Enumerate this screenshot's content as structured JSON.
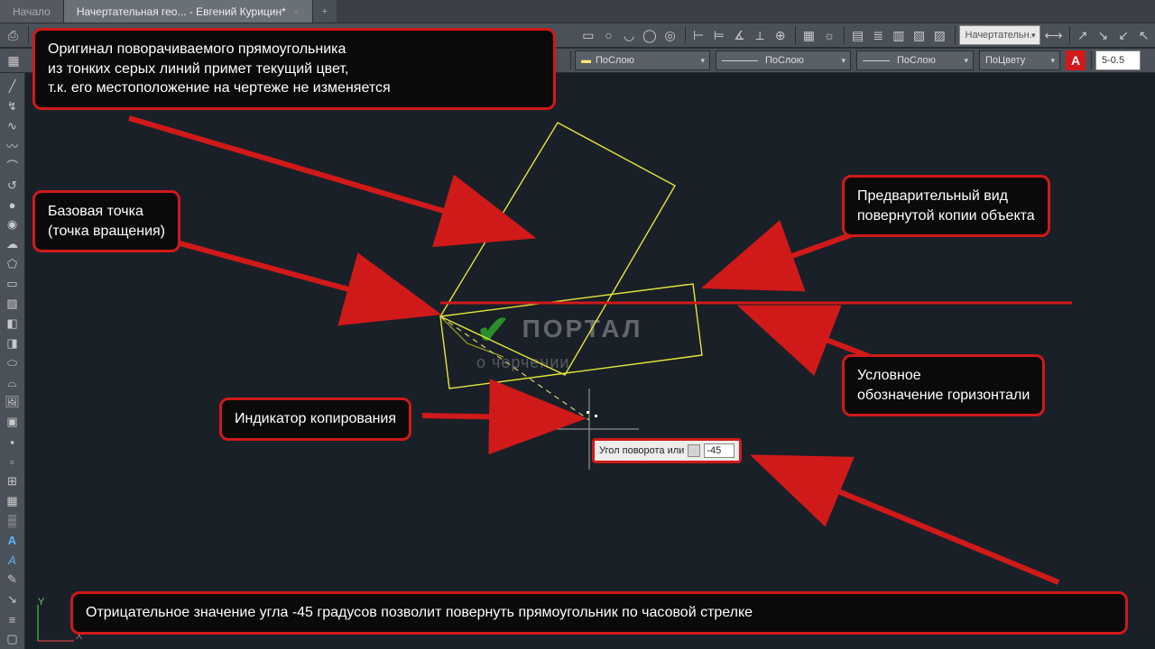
{
  "tabs": {
    "inactive": "Начало",
    "active": "Начертательная гео... - Евгений Курицин*"
  },
  "toolbar": {
    "layer_combo": "ПоСлою",
    "color_combo": "ПоЦвету",
    "style_combo": "Начертательн.",
    "scale_label": "5-0.5"
  },
  "annotations": {
    "original_rect": "Оригинал поворачиваемого прямоугольника\nиз тонких серых линий примет текущий цвет,\nт.к. его местоположение на чертеже не изменяется",
    "base_point": "Базовая точка\n(точка вращения)",
    "copy_indicator": "Индикатор копирования",
    "preview": "Предварительный вид\nповернутой копии объекта",
    "horizontal": "Условное\nобозначение горизонтали",
    "negative_angle": "Отрицательное значение угла -45 градусов позволит повернуть прямоугольник по часовой стрелке"
  },
  "tooltip": {
    "label": "Угол поворота или",
    "value": "-45"
  },
  "watermark": {
    "main": "ПОРТАЛ",
    "sub": "о черчении"
  },
  "ucs": {
    "x": "X",
    "y": "Y"
  }
}
